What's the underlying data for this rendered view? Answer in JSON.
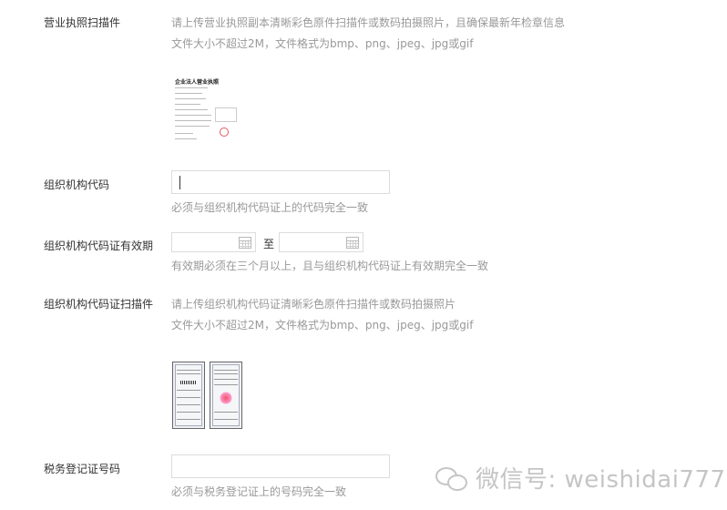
{
  "business_license": {
    "label": "营业执照扫描件",
    "hint_line1": "请上传营业执照副本清晰彩色原件扫描件或数码拍摄照片，且确保最新年检章信息",
    "hint_line2": "文件大小不超过2M，文件格式为bmp、png、jpeg、jpg或gif",
    "sample_title": "企业法人营业执照"
  },
  "org_code": {
    "label": "组织机构代码",
    "value": "",
    "hint": "必须与组织机构代码证上的代码完全一致"
  },
  "org_code_validity": {
    "label": "组织机构代码证有效期",
    "start_value": "",
    "to_label": "至",
    "end_value": "",
    "hint": "有效期必须在三个月以上，且与组织机构代码证上有效期完全一致"
  },
  "org_code_scan": {
    "label": "组织机构代码证扫描件",
    "hint_line1": "请上传组织机构代码证清晰彩色原件扫描件或数码拍摄照片",
    "hint_line2": "文件大小不超过2M，文件格式为bmp、png、jpeg、jpg或gif"
  },
  "tax_reg": {
    "label": "税务登记证号码",
    "value": "",
    "hint": "必须与税务登记证上的号码完全一致"
  },
  "watermark": {
    "text": "微信号: weishidai777",
    "icon": "wechat-icon"
  }
}
